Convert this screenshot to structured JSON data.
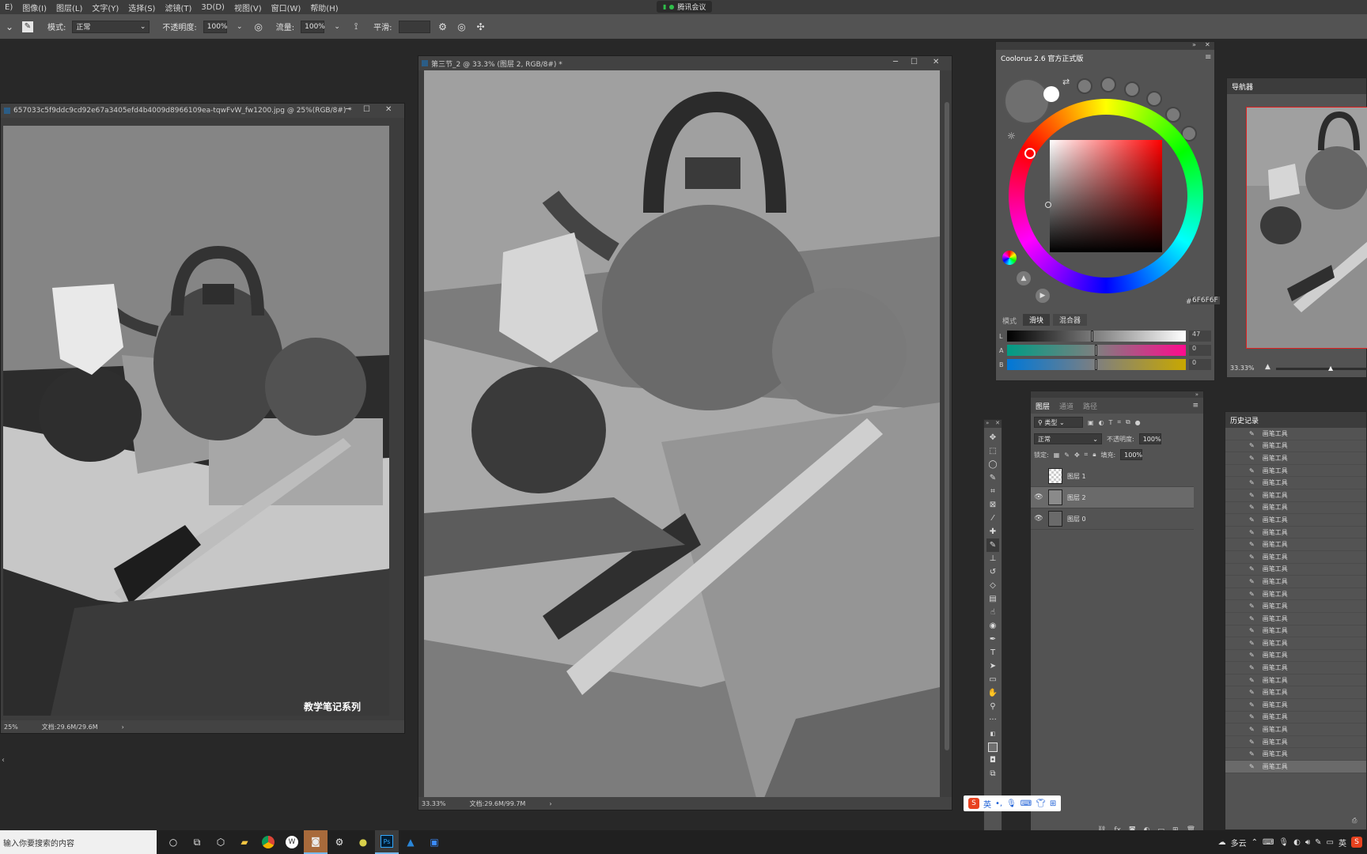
{
  "menubar": {
    "items": [
      "E)",
      "图像(I)",
      "图层(L)",
      "文字(Y)",
      "选择(S)",
      "滤镜(T)",
      "3D(D)",
      "视图(V)",
      "窗口(W)",
      "帮助(H)"
    ],
    "meeting_label": "腾讯会议"
  },
  "options": {
    "mode_label": "模式:",
    "mode_value": "正常",
    "opacity_label": "不透明度:",
    "opacity_value": "100%",
    "flow_label": "流量:",
    "flow_value": "100%",
    "smooth_label": "平滑:",
    "smooth_value": ""
  },
  "doc_left": {
    "title": "657033c5f9ddc9cd92e67a3405efd4b4009d8966109ea-tqwFvW_fw1200.jpg @ 25%(RGB/8#) *",
    "zoom": "25%",
    "doc_info": "文档:29.6M/29.6M",
    "watermark": "教学笔记系列"
  },
  "doc_main": {
    "title": "第三节_2 @ 33.3% (图层 2, RGB/8#) *",
    "zoom": "33.33%",
    "doc_info": "文档:29.6M/99.7M"
  },
  "coolorus": {
    "title": "Coolorus 2.6 官方正式版",
    "hex": "6F6F6F",
    "mode_label": "模式",
    "mode_tab_1": "滑块",
    "mode_tab_2": "混合器",
    "sliders": [
      {
        "label": "L",
        "value": "47"
      },
      {
        "label": "A",
        "value": "0"
      },
      {
        "label": "B",
        "value": "0"
      }
    ]
  },
  "navigator": {
    "title": "导航器",
    "zoom": "33.33%"
  },
  "layers_panel": {
    "tabs": [
      "图层",
      "通道",
      "路径"
    ],
    "filter_label": "类型",
    "blend_mode": "正常",
    "opacity_label": "不透明度:",
    "opacity_value": "100%",
    "lock_label": "锁定:",
    "fill_label": "填充:",
    "fill_value": "100%",
    "layers": [
      {
        "name": "图层 1",
        "visible": false,
        "selected": false
      },
      {
        "name": "图层 2",
        "visible": true,
        "selected": true
      },
      {
        "name": "图层 0",
        "visible": true,
        "selected": false
      }
    ]
  },
  "history": {
    "title": "历史记录",
    "item_label": "画笔工具",
    "items": [
      "画笔工具",
      "画笔工具",
      "画笔工具",
      "画笔工具",
      "画笔工具",
      "画笔工具",
      "画笔工具",
      "画笔工具",
      "画笔工具",
      "画笔工具",
      "画笔工具",
      "画笔工具",
      "画笔工具",
      "画笔工具",
      "画笔工具",
      "画笔工具",
      "画笔工具",
      "画笔工具",
      "画笔工具",
      "画笔工具",
      "画笔工具",
      "画笔工具",
      "画笔工具",
      "画笔工具",
      "画笔工具",
      "画笔工具",
      "画笔工具",
      "画笔工具"
    ]
  },
  "taskbar": {
    "search_placeholder": "输入你要搜索的内容",
    "weather": "多云",
    "lang": "英"
  },
  "ime": {
    "lang": "英"
  }
}
